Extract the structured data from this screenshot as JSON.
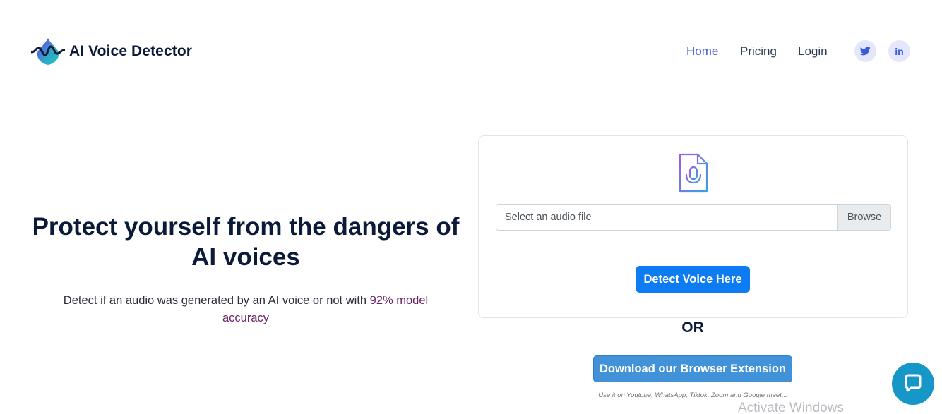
{
  "brand": {
    "name": "AI Voice Detector",
    "logo_icon": "waveform-drop-logo-icon"
  },
  "nav": {
    "items": [
      {
        "label": "Home",
        "active": true
      },
      {
        "label": "Pricing",
        "active": false
      },
      {
        "label": "Login",
        "active": false
      }
    ],
    "social": [
      {
        "icon": "twitter-icon"
      },
      {
        "icon": "linkedin-icon",
        "glyph": "in"
      }
    ]
  },
  "hero": {
    "title": "Protect yourself from the dangers of AI voices",
    "subtitle_prefix": "Detect if an audio was generated by an AI voice or not with ",
    "subtitle_accent": "92% model accuracy"
  },
  "upload": {
    "icon": "audio-file-icon",
    "placeholder": "Select an audio file",
    "browse_label": "Browse",
    "detect_label": "Detect Voice Here"
  },
  "separator": "OR",
  "extension": {
    "button_label": "Download our Browser Extension",
    "note": "Use it on Youtube, WhatsApp, Tiktok, Zoom and Google meet..."
  },
  "overlay": {
    "watermark": "Activate Windows",
    "chat_icon": "chat-bubble-icon"
  },
  "colors": {
    "accent": "#3b5bdb",
    "primary_button": "#0d7cf2",
    "extension_button": "#4192d9",
    "subtitle_accent": "#6b2166",
    "chat": "#1697c7"
  }
}
